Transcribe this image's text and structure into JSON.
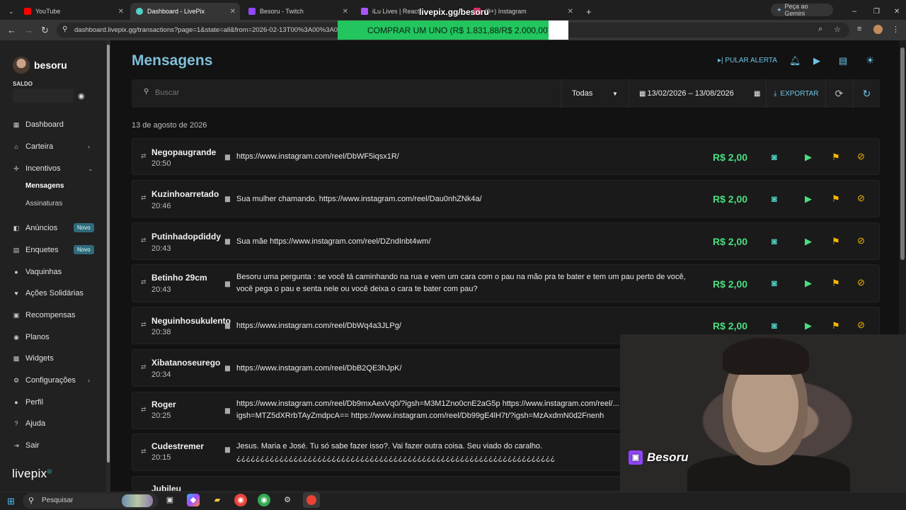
{
  "browser": {
    "tabs": [
      {
        "label": "YouTube",
        "favicon": "youtube-icon",
        "color": "#ff0000",
        "active": false
      },
      {
        "label": "Dashboard - LivePix",
        "favicon": "livepix-icon",
        "color": "#4fd1c5",
        "active": true
      },
      {
        "label": "Besoru - Twitch",
        "favicon": "twitch-icon",
        "color": "#9146ff",
        "active": false
      },
      {
        "label": "iLu Lives | React",
        "favicon": "ilu-icon",
        "color": "#a855f7",
        "active": false
      },
      {
        "label": "(9+) Instagram",
        "favicon": "instagram-icon",
        "color": "#e1306c",
        "active": false
      }
    ],
    "gemini_button": "Peça ao Gemini",
    "url": "dashboard.livepix.gg/transactions?page=1&state=all&from=2026-02-13T00%3A00%3A00"
  },
  "overlay": {
    "title": "livepix.gg/besoru",
    "goal_bar": "COMPRAR UM UNO (R$ 1.831,88/R$ 2.000,00)",
    "goal_color": "#22c55e"
  },
  "sidebar": {
    "username": "besoru",
    "saldo_label": "SALDO",
    "items": [
      {
        "label": "Dashboard",
        "icon": "dashboard-icon",
        "glyph": "▦"
      },
      {
        "label": "Carteira",
        "icon": "wallet-icon",
        "glyph": "⌂",
        "chevron": "›"
      },
      {
        "label": "Incentivos",
        "icon": "incentives-icon",
        "glyph": "✢",
        "chevron": "⌄"
      },
      {
        "label": "Anúncios",
        "icon": "ads-icon",
        "glyph": "◧",
        "badge": "Novo"
      },
      {
        "label": "Enquetes",
        "icon": "polls-icon",
        "glyph": "▤",
        "badge": "Novo"
      },
      {
        "label": "Vaquinhas",
        "icon": "piggy-icon",
        "glyph": "●"
      },
      {
        "label": "Ações Solidárias",
        "icon": "charity-icon",
        "glyph": "♥"
      },
      {
        "label": "Recompensas",
        "icon": "rewards-icon",
        "glyph": "▣"
      },
      {
        "label": "Planos",
        "icon": "plans-icon",
        "glyph": "◉"
      },
      {
        "label": "Widgets",
        "icon": "widgets-icon",
        "glyph": "▩"
      },
      {
        "label": "Configurações",
        "icon": "settings-icon",
        "glyph": "⚙",
        "chevron": "›"
      },
      {
        "label": "Perfil",
        "icon": "profile-icon",
        "glyph": "●"
      },
      {
        "label": "Ajuda",
        "icon": "help-icon",
        "glyph": "?"
      },
      {
        "label": "Sair",
        "icon": "logout-icon",
        "glyph": "⇥"
      }
    ],
    "sub_items": [
      "Mensagens",
      "Assinaturas"
    ],
    "logo": "livepix"
  },
  "main": {
    "title": "Mensagens",
    "actions": {
      "skip_alert": "PULAR ALERTA"
    },
    "filters": {
      "search_placeholder": "Buscar",
      "status": "Todas",
      "date_range": "13/02/2026 – 13/08/2026",
      "export": "EXPORTAR"
    },
    "date_header": "13 de agosto de 2026",
    "rows": [
      {
        "name": "Negopaugrande",
        "time": "20:50",
        "message": "https://www.instagram.com/reel/DbWF5iqsx1R/",
        "amount": "R$ 2,00"
      },
      {
        "name": "Kuzinhoarretado",
        "time": "20:46",
        "message": "Sua mulher chamando. https://www.instagram.com/reel/Dau0nhZNk4a/",
        "amount": "R$ 2,00"
      },
      {
        "name": "Putinhadopdiddy",
        "time": "20:43",
        "message": "Sua mãe https://www.instagram.com/reel/DZndInbt4wm/",
        "amount": "R$ 2,00"
      },
      {
        "name": "Betinho 29cm",
        "time": "20:43",
        "message": "Besoru uma pergunta : se você tá caminhando na rua e vem um cara com o pau na mão pra te bater e tem um pau perto de você, você pega o pau e senta nele ou você deixa o cara te bater com pau?",
        "amount": "R$ 2,00"
      },
      {
        "name": "Neguinhosukulento",
        "time": "20:38",
        "message": "https://www.instagram.com/reel/DbWq4a3JLPg/",
        "amount": "R$ 2,00"
      },
      {
        "name": "Xibatanoseurego",
        "time": "20:34",
        "message": "https://www.instagram.com/reel/DbB2QE3hJpK/",
        "amount": ""
      },
      {
        "name": "Roger",
        "time": "20:25",
        "message": "https://www.instagram.com/reel/Db9mxAexVq0/?igsh=M3M1Zno0cnE2aG5p https://www.instagram.com/reel/... igsh=MTZ5dXRrbTAyZmdpcA== https://www.instagram.com/reel/Db99gE4lH7t/?igsh=MzAxdmN0d2Fnenh",
        "amount": ""
      },
      {
        "name": "Cudestremer",
        "time": "20:15",
        "message": "Jesus. Maria e José. Tu só sabe fazer isso?. Vai fazer outra coisa. Seu viado do caralho. ¿¿¿¿¿¿¿¿¿¿¿¿¿¿¿¿¿¿¿¿¿¿¿¿¿¿¿¿¿¿¿¿¿¿¿¿¿¿¿¿¿¿¿¿¿¿¿¿¿¿¿¿¿¿¿¿¿¿¿¿¿¿¿¿¿¿¿",
        "amount": ""
      },
      {
        "name": "Jubileu",
        "time": "",
        "message": "",
        "amount": ""
      }
    ],
    "amount_color": "#4ade80"
  },
  "webcam": {
    "tag": "Besoru"
  },
  "taskbar": {
    "search_placeholder": "Pesquisar"
  }
}
